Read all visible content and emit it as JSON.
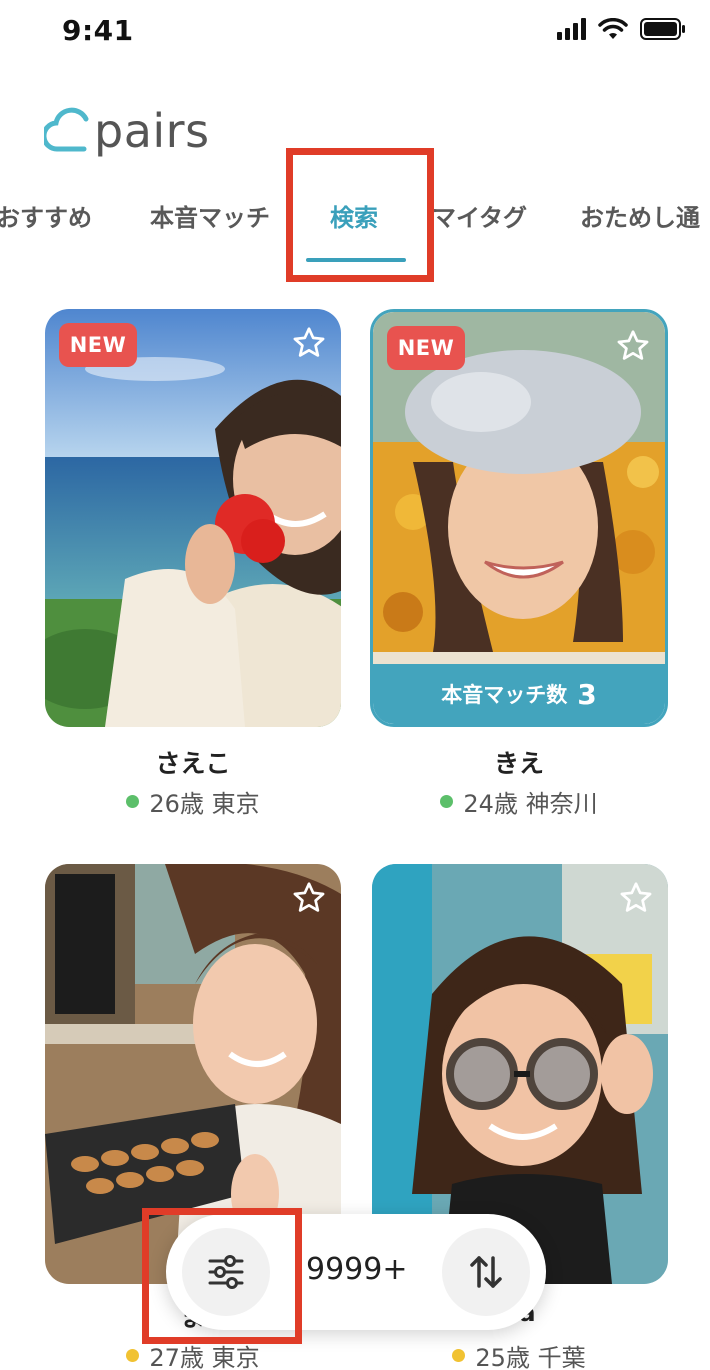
{
  "status_bar": {
    "time": "9:41"
  },
  "app": {
    "logo_text": "pairs"
  },
  "tabs": [
    {
      "label": "おすすめ"
    },
    {
      "label": "本音マッチ"
    },
    {
      "label": "検索",
      "active": true
    },
    {
      "label": "マイタグ"
    },
    {
      "label": "おためし通"
    }
  ],
  "cards": [
    {
      "badge": "NEW",
      "name": "さえこ",
      "age_location": "26歳 東京",
      "status_color": "#5cbf6a"
    },
    {
      "badge": "NEW",
      "name": "きえ",
      "age_location": "24歳 神奈川",
      "status_color": "#5cbf6a",
      "match_label": "本音マッチ数",
      "match_count": "3"
    },
    {
      "name": "ま",
      "age_location": "27歳 東京",
      "status_color": "#f1c232"
    },
    {
      "name": "ya",
      "age_location": "25歳 千葉",
      "status_color": "#f1c232"
    }
  ],
  "bottom_bar": {
    "result_count": "9999+"
  },
  "colors": {
    "accent": "#3aa0bb",
    "new_badge": "#e8534f",
    "highlight": "#e03c28"
  }
}
